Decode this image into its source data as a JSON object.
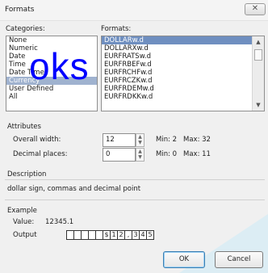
{
  "window": {
    "title": "Formats",
    "close_glyph": "✕"
  },
  "categories": {
    "label": "Categories:",
    "items": [
      "None",
      "Numeric",
      "Date",
      "Time",
      "Date Time",
      "Currency",
      "User Defined",
      "All"
    ],
    "selected_index": 5
  },
  "formats": {
    "label": "Formats:",
    "items": [
      "DOLLARw.d",
      "DOLLARXw.d",
      "EURFRATSw.d",
      "EURFRBEFw.d",
      "EURFRCHFw.d",
      "EURFRCZKw.d",
      "EURFRDEMw.d",
      "EURFRDKKw.d"
    ],
    "selected_index": 0
  },
  "attributes": {
    "label": "Attributes",
    "overall_width": {
      "label": "Overall width:",
      "value": "12",
      "min": "Min: 2",
      "max": "Max: 32"
    },
    "decimal_places": {
      "label": "Decimal places:",
      "value": "0",
      "min": "Min: 0",
      "max": "Max: 11"
    }
  },
  "description": {
    "label": "Description",
    "text": "dollar sign, commas and decimal point"
  },
  "example": {
    "label": "Example",
    "value_label": "Value:",
    "value": "12345.1",
    "output_label": "Output",
    "output_cells": [
      "",
      "",
      "",
      "",
      "",
      "$",
      "1",
      "2",
      ",",
      "3",
      "4",
      "5"
    ]
  },
  "buttons": {
    "ok": "OK",
    "cancel": "Cancel"
  },
  "watermark": "oks",
  "colors": {
    "selection": "#6f8fc0",
    "watermark": "#0000ff",
    "teal_accent": "#d9eef5"
  }
}
